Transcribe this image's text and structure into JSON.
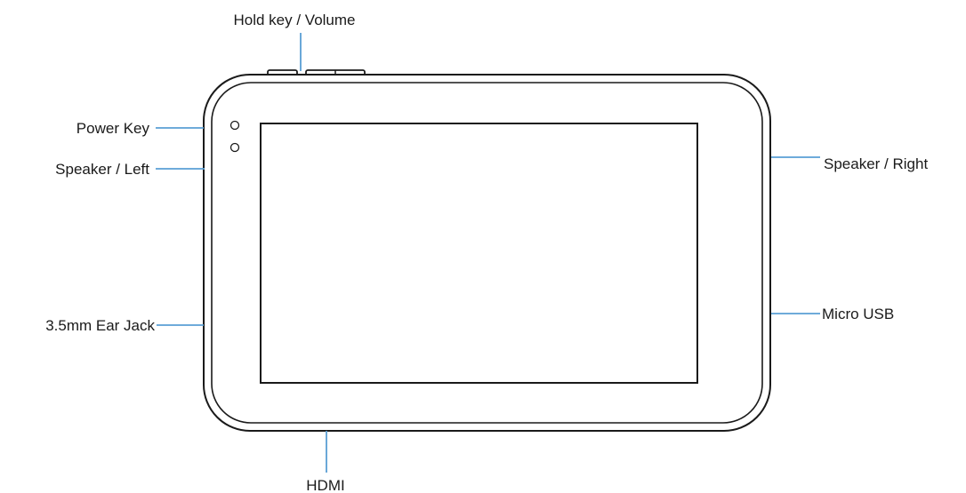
{
  "labels": {
    "hold_key_volume": "Hold key / Volume",
    "power_key": "Power Key",
    "speaker_left": "Speaker / Left",
    "ear_jack": "3.5mm Ear Jack",
    "speaker_right": "Speaker / Right",
    "micro_usb": "Micro USB",
    "hdmi": "HDMI"
  },
  "colors": {
    "outline": "#1a1a1a",
    "leader_line": "#5a9fd4",
    "text": "#1a1a1a"
  }
}
